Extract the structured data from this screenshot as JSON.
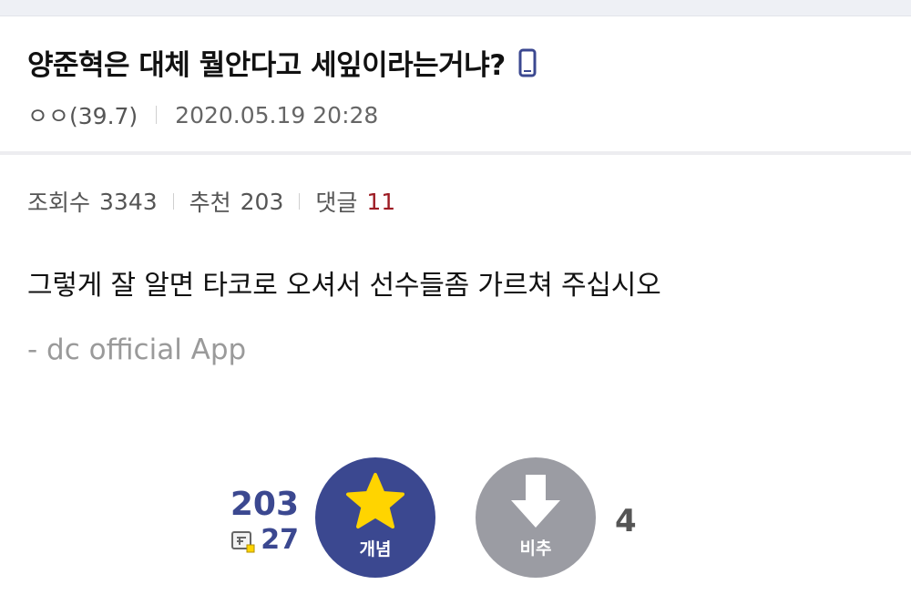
{
  "post": {
    "title": "양준혁은 대체 뭘안다고 세잎이라는거냐?",
    "title_icon": "mobile-phone-icon",
    "writer": "ㅇㅇ(39.7)",
    "date": "2020.05.19 20:28"
  },
  "stats": {
    "views_label": "조회수",
    "views": "3343",
    "recommend_label": "추천",
    "recommend": "203",
    "comments_label": "댓글",
    "comments": "11"
  },
  "content": {
    "body": "그렇게 잘 알면 타코로 오셔서 선수들좀 가르쳐 주십시오",
    "signature": "- dc official App"
  },
  "vote": {
    "up_total": "203",
    "up_fixed": "27",
    "up_label": "개념",
    "down_label": "비추",
    "down_count": "4"
  },
  "colors": {
    "accent": "#3b4890",
    "comment_count": "#9d1c24",
    "star": "#ffd400",
    "down_button": "#9b9ca3"
  }
}
